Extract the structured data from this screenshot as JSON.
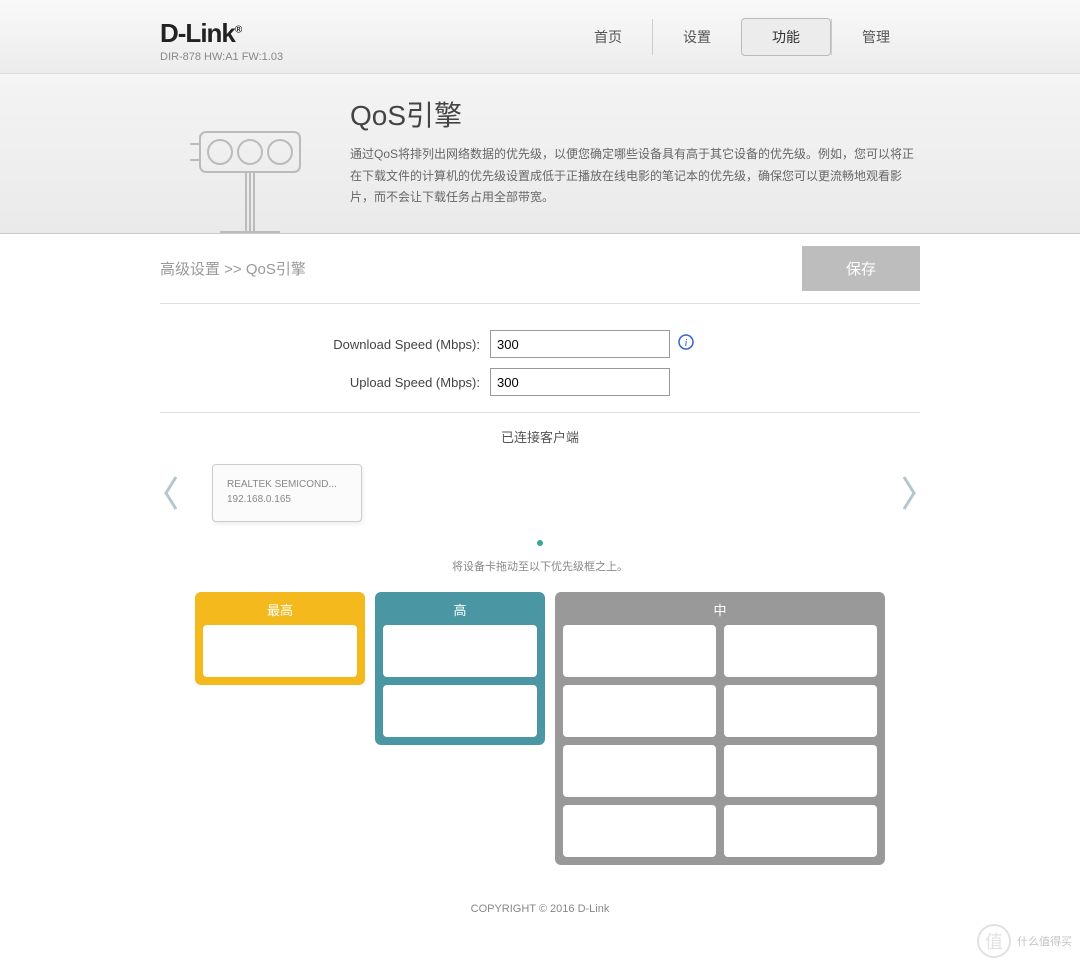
{
  "header": {
    "brand": "D-Link",
    "model": "DIR-878 HW:A1 FW:1.03",
    "nav": [
      "首页",
      "设置",
      "功能",
      "管理"
    ],
    "active_index": 2
  },
  "hero": {
    "title": "QoS引擎",
    "desc": "通过QoS将排列出网络数据的优先级，以便您确定哪些设备具有高于其它设备的优先级。例如，您可以将正在下载文件的计算机的优先级设置成低于正播放在线电影的笔记本的优先级，确保您可以更流畅地观看影片，而不会让下载任务占用全部带宽。"
  },
  "breadcrumb": "高级设置 >> QoS引擎",
  "save_label": "保存",
  "form": {
    "download_label": "Download Speed (Mbps):",
    "download_value": "300",
    "upload_label": "Upload Speed (Mbps):",
    "upload_value": "300"
  },
  "clients": {
    "title": "已连接客户端",
    "items": [
      {
        "name": "REALTEK SEMICOND...",
        "ip": "192.168.0.165"
      }
    ]
  },
  "drag_hint": "将设备卡拖动至以下优先级框之上。",
  "priority": {
    "highest": "最高",
    "high": "高",
    "medium": "中"
  },
  "footer": "COPYRIGHT © 2016 D-Link",
  "watermark": {
    "glyph": "值",
    "text": "什么值得买"
  }
}
